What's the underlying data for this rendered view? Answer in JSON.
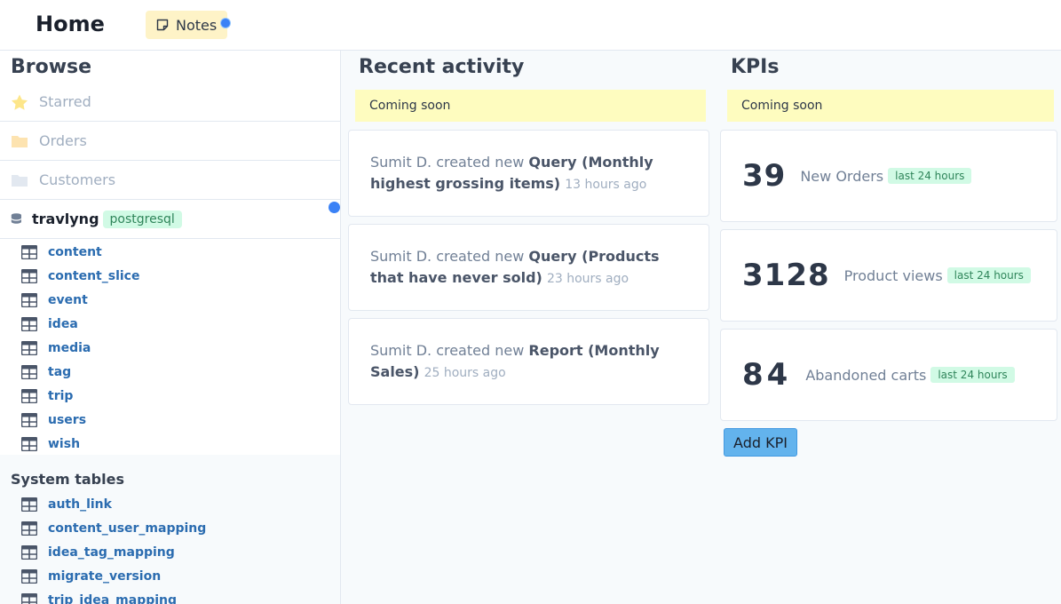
{
  "header": {
    "title": "Home",
    "notes_label": "Notes"
  },
  "sidebar": {
    "title": "Browse",
    "starred": "Starred",
    "orders": "Orders",
    "customers": "Customers",
    "database": {
      "name": "travlyng",
      "badge": "postgresql"
    },
    "tables": [
      "content",
      "content_slice",
      "event",
      "idea",
      "media",
      "tag",
      "trip",
      "users",
      "wish"
    ],
    "system_title": "System tables",
    "system_tables": [
      "auth_link",
      "content_user_mapping",
      "idea_tag_mapping",
      "migrate_version",
      "trip_idea_mapping"
    ]
  },
  "activity": {
    "title": "Recent activity",
    "coming_soon": "Coming soon",
    "items": [
      {
        "user": "Sumit D.",
        "action": "created new",
        "object": "Query (Monthly highest grossing items)",
        "ago": "13 hours ago"
      },
      {
        "user": "Sumit D.",
        "action": "created new",
        "object": "Query (Products that have never sold)",
        "ago": "23 hours ago"
      },
      {
        "user": "Sumit D.",
        "action": "created new",
        "object": "Report (Monthly Sales)",
        "ago": "25 hours ago"
      }
    ]
  },
  "kpis": {
    "title": "KPIs",
    "coming_soon": "Coming soon",
    "items": [
      {
        "value": "39",
        "label": "New Orders",
        "badge": "last 24 hours"
      },
      {
        "value": "3128",
        "label": "Product views",
        "badge": "last 24 hours"
      },
      {
        "value": "84",
        "label": "Abandoned carts",
        "badge": "last 24 hours"
      }
    ],
    "add_label": "Add KPI"
  },
  "colors": {
    "accent": "#3b82f6",
    "link": "#2b6cb0",
    "badge_bg": "#d1fae5",
    "soon_bg": "#fefcbf"
  }
}
